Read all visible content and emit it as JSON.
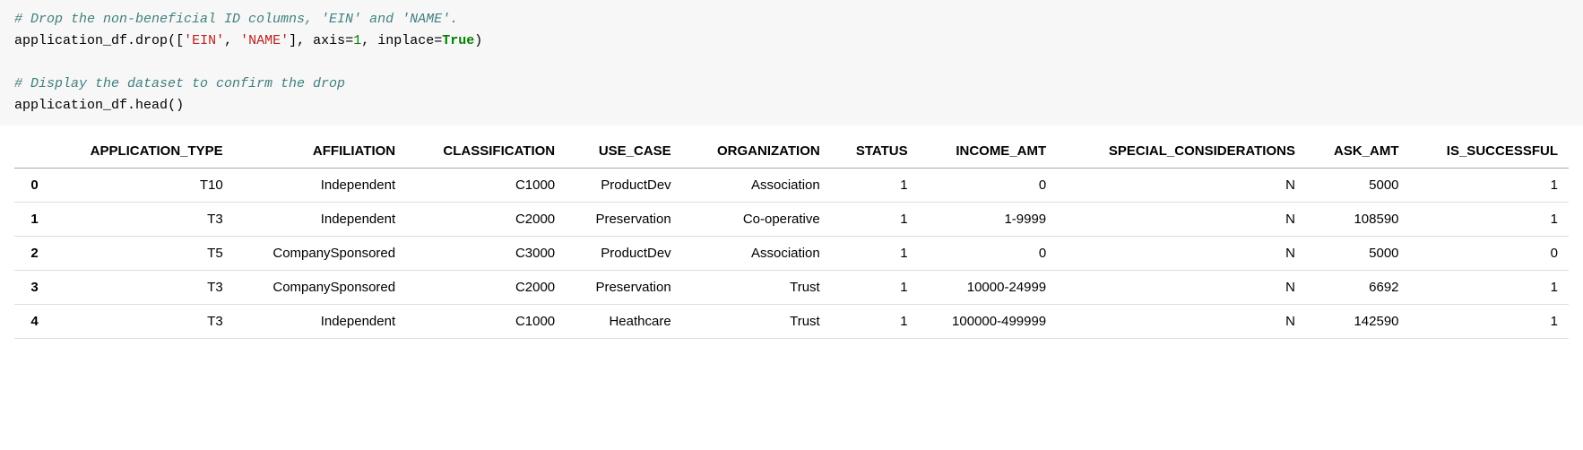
{
  "code": {
    "comment1": "# Drop the non-beneficial ID columns, 'EIN' and 'NAME'.",
    "line2_ident1": "application_df",
    "line2_dot1": ".",
    "line2_method": "drop",
    "line2_open": "(",
    "line2_lbrack": "[",
    "line2_str1": "'EIN'",
    "line2_comma1": ", ",
    "line2_str2": "'NAME'",
    "line2_rbrack": "]",
    "line2_comma2": ", ",
    "line2_kw1": "axis",
    "line2_eq1": "=",
    "line2_num1": "1",
    "line2_comma3": ", ",
    "line2_kw2": "inplace",
    "line2_eq2": "=",
    "line2_bool": "True",
    "line2_close": ")",
    "comment2": "# Display the dataset to confirm the drop",
    "line4_ident": "application_df",
    "line4_dot": ".",
    "line4_method": "head",
    "line4_open": "(",
    "line4_close": ")"
  },
  "table": {
    "columns": [
      "APPLICATION_TYPE",
      "AFFILIATION",
      "CLASSIFICATION",
      "USE_CASE",
      "ORGANIZATION",
      "STATUS",
      "INCOME_AMT",
      "SPECIAL_CONSIDERATIONS",
      "ASK_AMT",
      "IS_SUCCESSFUL"
    ],
    "index": [
      "0",
      "1",
      "2",
      "3",
      "4"
    ],
    "rows": [
      [
        "T10",
        "Independent",
        "C1000",
        "ProductDev",
        "Association",
        "1",
        "0",
        "N",
        "5000",
        "1"
      ],
      [
        "T3",
        "Independent",
        "C2000",
        "Preservation",
        "Co-operative",
        "1",
        "1-9999",
        "N",
        "108590",
        "1"
      ],
      [
        "T5",
        "CompanySponsored",
        "C3000",
        "ProductDev",
        "Association",
        "1",
        "0",
        "N",
        "5000",
        "0"
      ],
      [
        "T3",
        "CompanySponsored",
        "C2000",
        "Preservation",
        "Trust",
        "1",
        "10000-24999",
        "N",
        "6692",
        "1"
      ],
      [
        "T3",
        "Independent",
        "C1000",
        "Heathcare",
        "Trust",
        "1",
        "100000-499999",
        "N",
        "142590",
        "1"
      ]
    ]
  },
  "chart_data": {
    "type": "table",
    "title": "",
    "columns": [
      "APPLICATION_TYPE",
      "AFFILIATION",
      "CLASSIFICATION",
      "USE_CASE",
      "ORGANIZATION",
      "STATUS",
      "INCOME_AMT",
      "SPECIAL_CONSIDERATIONS",
      "ASK_AMT",
      "IS_SUCCESSFUL"
    ],
    "index": [
      0,
      1,
      2,
      3,
      4
    ],
    "data": [
      [
        "T10",
        "Independent",
        "C1000",
        "ProductDev",
        "Association",
        1,
        "0",
        "N",
        5000,
        1
      ],
      [
        "T3",
        "Independent",
        "C2000",
        "Preservation",
        "Co-operative",
        1,
        "1-9999",
        "N",
        108590,
        1
      ],
      [
        "T5",
        "CompanySponsored",
        "C3000",
        "ProductDev",
        "Association",
        1,
        "0",
        "N",
        5000,
        0
      ],
      [
        "T3",
        "CompanySponsored",
        "C2000",
        "Preservation",
        "Trust",
        1,
        "10000-24999",
        "N",
        6692,
        1
      ],
      [
        "T3",
        "Independent",
        "C1000",
        "Heathcare",
        "Trust",
        1,
        "100000-499999",
        "N",
        142590,
        1
      ]
    ]
  }
}
